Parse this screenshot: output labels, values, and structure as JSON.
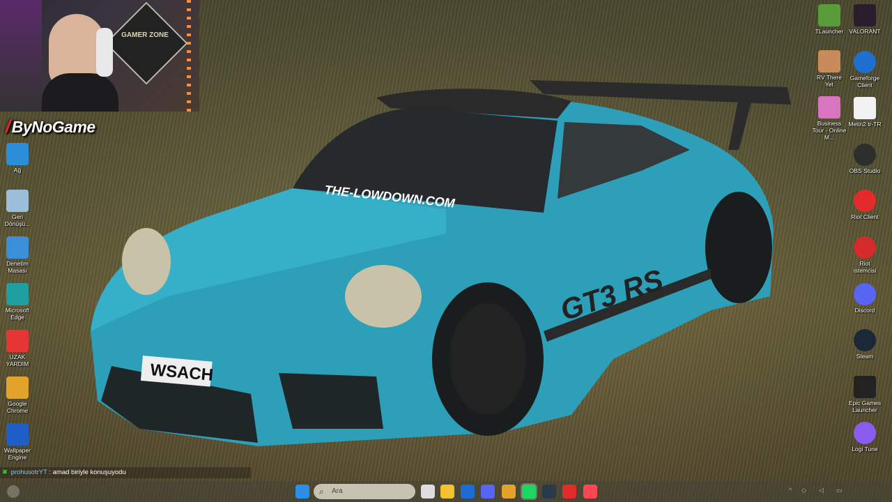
{
  "webcam": {
    "poster_text": "GAMER ZONE"
  },
  "channel": {
    "name": "ByNoGame"
  },
  "left_icons": [
    {
      "label": "Ağ",
      "icon": "network-icon",
      "color": "#2a8fd8"
    },
    {
      "label": "Geri Dönüşü...",
      "icon": "recycle-bin-icon",
      "color": "#9bbfd8"
    },
    {
      "label": "Denetim Masası",
      "icon": "control-panel-icon",
      "color": "#3b8fd8"
    },
    {
      "label": "Microsoft Edge",
      "icon": "edge-icon",
      "color": "#1fa0a0"
    },
    {
      "label": "UZAK YARDIM",
      "icon": "anydesk-icon",
      "color": "#e63535"
    },
    {
      "label": "Google Chrome",
      "icon": "chrome-icon",
      "color": "#e2a32a"
    },
    {
      "label": "Wallpaper Engine",
      "icon": "wallpaper-engine-icon",
      "color": "#1e5fc7"
    }
  ],
  "right_icons_col1": [
    {
      "label": "TLauncher",
      "icon": "tlauncher-icon",
      "color": "#5a9b3a"
    },
    {
      "label": "RV There Yet",
      "icon": "rv-there-yet-icon",
      "color": "#c88b5a"
    },
    {
      "label": "Business Tour - Online M...",
      "icon": "business-tour-icon",
      "color": "#d874c0"
    }
  ],
  "right_icons_col2": [
    {
      "label": "VALORANT",
      "icon": "valorant-icon",
      "color": "#2a1e2e"
    },
    {
      "label": "Gameforge Client",
      "icon": "gameforge-icon",
      "color": "#1f6fd0"
    },
    {
      "label": "Metin2 tr-TR",
      "icon": "file-icon",
      "color": "#f2f2f2"
    },
    {
      "label": "OBS Studio",
      "icon": "obs-icon",
      "color": "#2e2e2e"
    },
    {
      "label": "Riot Client",
      "icon": "riot-client-icon",
      "color": "#e32b2b"
    },
    {
      "label": "Riot istemcisi",
      "icon": "riot-icon",
      "color": "#d42a2a"
    },
    {
      "label": "Discord",
      "icon": "discord-icon",
      "color": "#5865f2"
    },
    {
      "label": "Steam",
      "icon": "steam-icon",
      "color": "#1b2838"
    },
    {
      "label": "Epic Games Launcher",
      "icon": "epic-games-icon",
      "color": "#222222"
    },
    {
      "label": "Logi Tune",
      "icon": "logi-tune-icon",
      "color": "#8a5cf0"
    }
  ],
  "car": {
    "windshield_text": "THE-LOWDOWN.COM",
    "plate": "WSACH",
    "side_text": "GT3 RS"
  },
  "chat": {
    "user": "prohusotrYT",
    "message": " : amad biriyle konuşuyodu"
  },
  "taskbar": {
    "search_placeholder": "Ara",
    "apps": [
      {
        "name": "start-icon",
        "color": "#2b8fe8"
      },
      {
        "name": "task-view-icon",
        "color": "#dddddd"
      },
      {
        "name": "file-explorer-icon",
        "color": "#f2c230"
      },
      {
        "name": "store-icon",
        "color": "#1c6ed4"
      },
      {
        "name": "discord-icon",
        "color": "#5865f2"
      },
      {
        "name": "chrome-icon",
        "color": "#e2a32a"
      },
      {
        "name": "spotify-icon",
        "color": "#1ed760"
      },
      {
        "name": "steam-icon",
        "color": "#2a3a4a"
      },
      {
        "name": "riot-client-icon",
        "color": "#e32b2b"
      },
      {
        "name": "valorant-icon",
        "color": "#ff4655"
      }
    ]
  }
}
